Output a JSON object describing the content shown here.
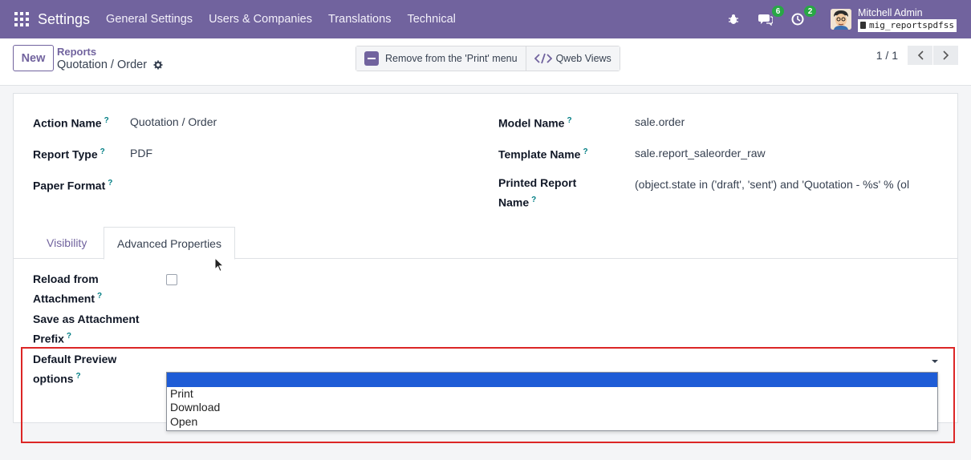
{
  "navbar": {
    "brand": "Settings",
    "menu": [
      "General Settings",
      "Users & Companies",
      "Translations",
      "Technical"
    ],
    "messages_count": "6",
    "activities_count": "2",
    "user_name": "Mitchell Admin",
    "database": "mig_reportspdfss",
    "bg_color": "#71639e"
  },
  "control_panel": {
    "new_label": "New",
    "breadcrumb_parent": "Reports",
    "breadcrumb_current": "Quotation / Order",
    "remove_print_label": "Remove from the 'Print' menu",
    "qweb_views_label": "Qweb Views",
    "pager": "1 / 1"
  },
  "form": {
    "action_name_label": "Action Name",
    "action_name_value": "Quotation / Order",
    "report_type_label": "Report Type",
    "report_type_value": "PDF",
    "paper_format_label": "Paper Format",
    "model_name_label": "Model Name",
    "model_name_value": "sale.order",
    "template_name_label": "Template Name",
    "template_name_value": "sale.report_saleorder_raw",
    "printed_report_label_1": "Printed Report",
    "printed_report_label_2": "Name",
    "printed_report_value": "(object.state in ('draft', 'sent') and 'Quotation - %s' % (ol",
    "help_mark": "?"
  },
  "tabs": [
    "Visibility",
    "Advanced Properties"
  ],
  "advanced": {
    "reload_label_1": "Reload from",
    "reload_label_2": "Attachment",
    "reload_checked": false,
    "attachment_label_1": "Save as Attachment",
    "attachment_label_2": "Prefix",
    "preview_label_1": "Default Preview",
    "preview_label_2": "options",
    "preview_selected": "",
    "preview_options": [
      "",
      "Print",
      "Download",
      "Open"
    ]
  },
  "colors": {
    "accent": "#71639e",
    "help": "#017e84",
    "highlight": "#dc2626",
    "option_selected": "#1e5cd6"
  }
}
